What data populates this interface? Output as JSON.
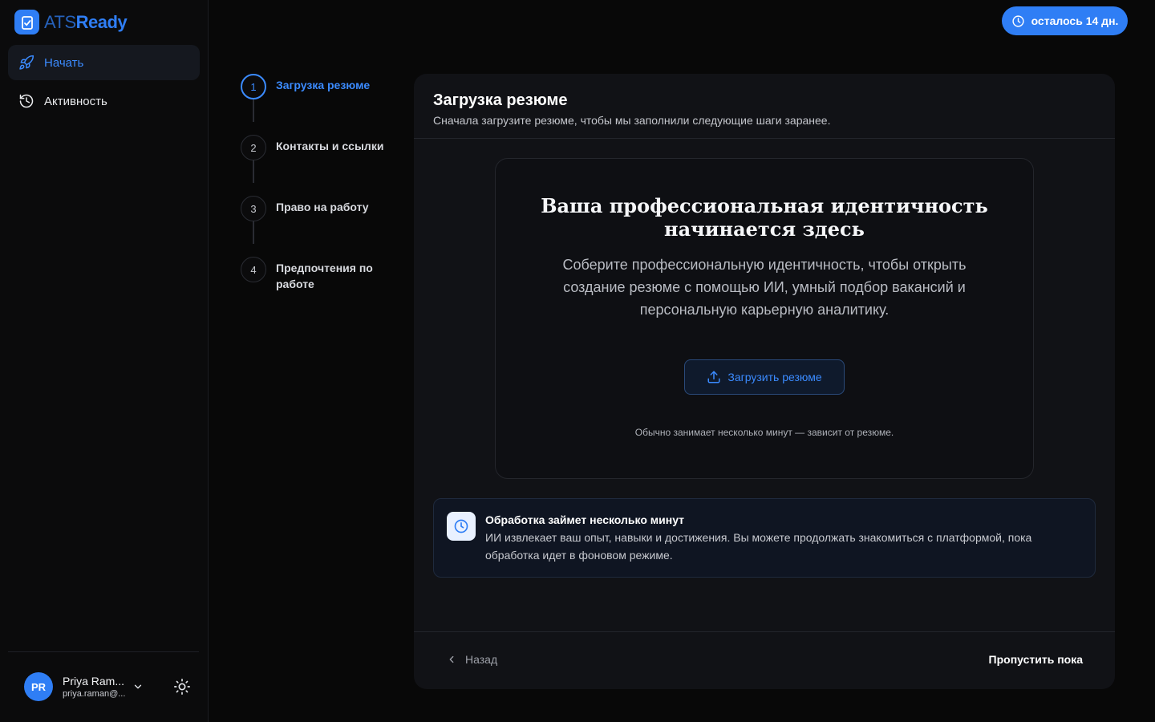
{
  "app": {
    "logo_part1": "ATS",
    "logo_part2": "Ready",
    "accent": "#2f7ef5"
  },
  "sidebar": {
    "items": [
      {
        "label": "Начать",
        "icon": "rocket-icon",
        "active": true
      },
      {
        "label": "Активность",
        "icon": "history-icon",
        "active": false
      }
    ],
    "user": {
      "initials": "PR",
      "name": "Priya Ram...",
      "email": "priya.raman@..."
    }
  },
  "trial": {
    "label": "осталось 14 дн.",
    "icon": "clock-icon"
  },
  "steps": [
    {
      "number": "1",
      "label": "Загрузка резюме",
      "active": true
    },
    {
      "number": "2",
      "label": "Контакты и ссылки",
      "active": false
    },
    {
      "number": "3",
      "label": "Право на работу",
      "active": false
    },
    {
      "number": "4",
      "label": "Предпочтения по работе",
      "active": false
    }
  ],
  "main": {
    "title": "Загрузка резюме",
    "subtitle": "Сначала загрузите резюме, чтобы мы заполнили следующие шаги заранее.",
    "hero_title": "Ваша профессиональная идентичность начинается здесь",
    "hero_text": "Соберите профессиональную идентичность, чтобы открыть создание резюме с помощью ИИ, умный подбор вакансий и персональную карьерную аналитику.",
    "upload_label": "Загрузить резюме",
    "hint": "Обычно занимает несколько минут — зависит от резюме.",
    "notice_title": "Обработка займет несколько минут",
    "notice_text": "ИИ извлекает ваш опыт, навыки и достижения. Вы можете продолжать знакомиться с платформой, пока обработка идет в фоновом режиме.",
    "back_label": "Назад",
    "skip_label": "Пропустить пока"
  }
}
